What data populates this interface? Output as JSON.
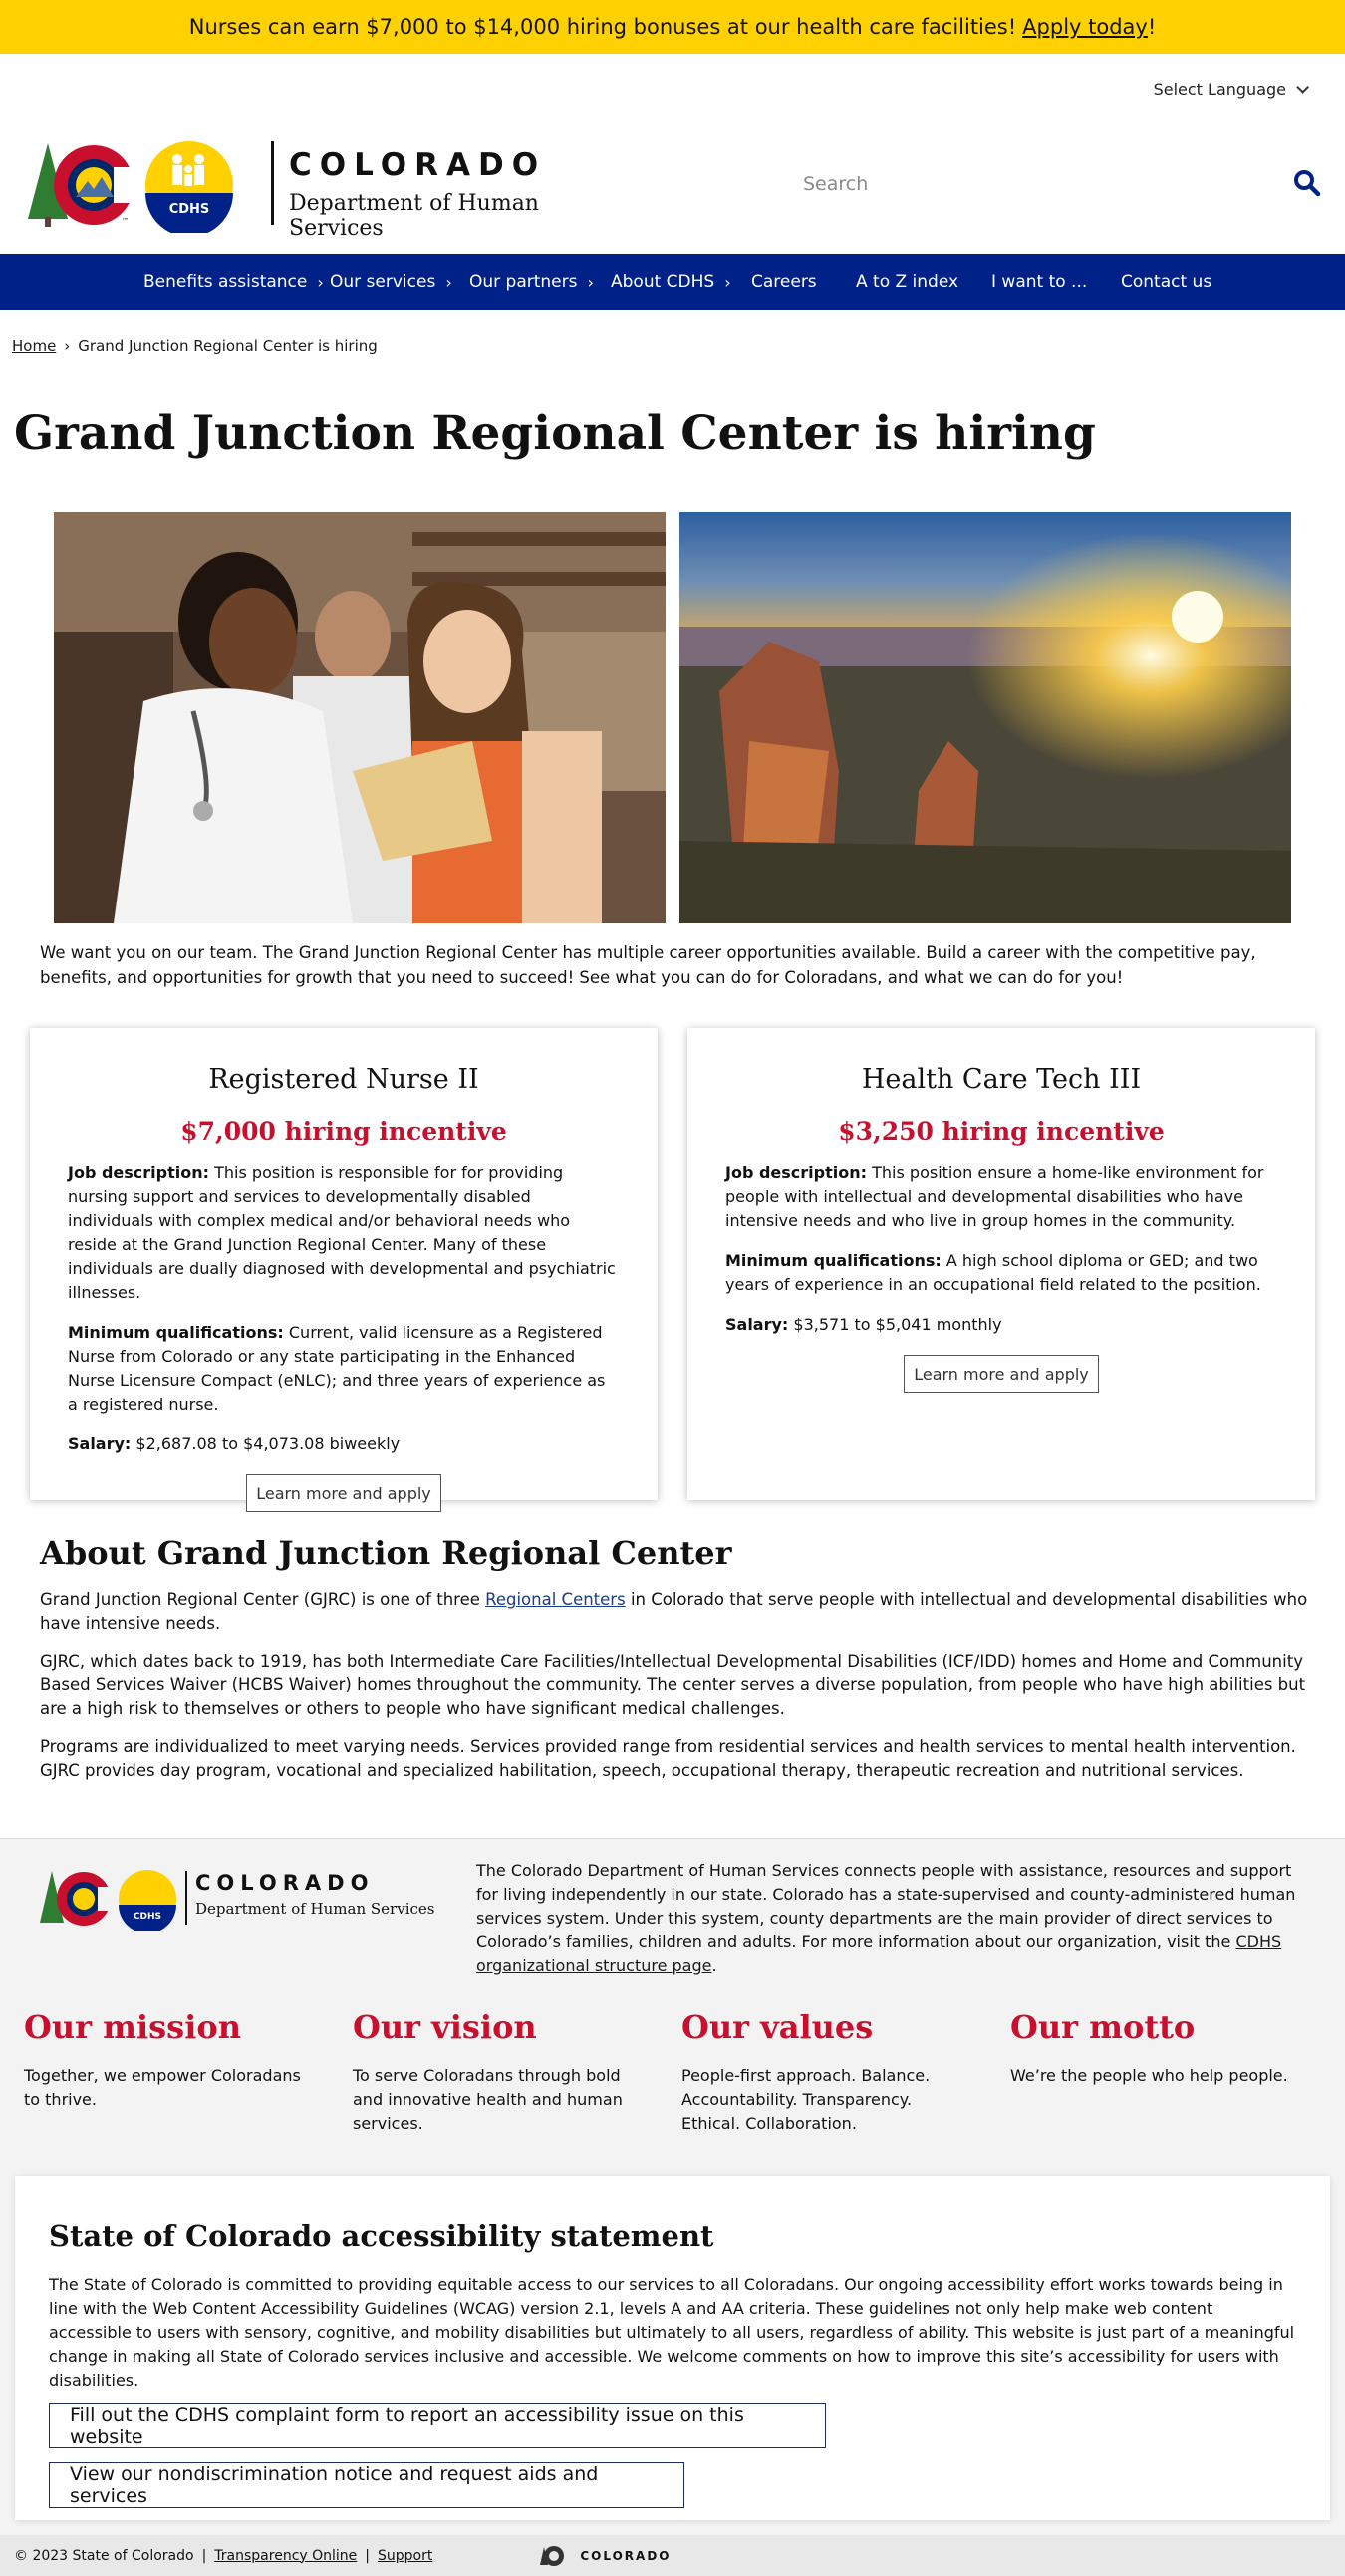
{
  "banner": {
    "text": "Nurses can earn $7,000 to $14,000 hiring bonuses at our health care facilities!",
    "link": "Apply today",
    "suffix": "!"
  },
  "header": {
    "language": "Select Language",
    "logo_state": "COLORADO",
    "logo_dept": "Department of Human Services",
    "logo_badge": "CDHS",
    "search_placeholder": "Search"
  },
  "nav": {
    "items": [
      {
        "label": "Benefits assistance",
        "arrow": "›"
      },
      {
        "label": "Our services",
        "arrow": "›"
      },
      {
        "label": "Our partners",
        "arrow": "›"
      },
      {
        "label": "About CDHS",
        "arrow": "›"
      },
      {
        "label": "Careers"
      },
      {
        "label": "A to Z index"
      },
      {
        "label": "I want to ..."
      },
      {
        "label": "Contact us"
      }
    ]
  },
  "breadcrumb": {
    "home": "Home",
    "sep": "›",
    "current": "Grand Junction Regional Center is hiring"
  },
  "page_title": "Grand Junction Regional Center is hiring",
  "intro": "We want you on our team. The Grand Junction Regional Center has multiple career opportunities available. Build a career with the competitive pay, benefits, and opportunities for growth that you need to succeed! See what you can do for Coloradans, and what we can do for you!",
  "jobs": [
    {
      "title": "Registered Nurse II",
      "incentive": "$7,000 hiring incentive",
      "desc_label": "Job description:",
      "desc": "This position is responsible for for providing nursing support and services to developmentally disabled individuals with complex medical and/or behavioral needs who reside at the Grand Junction Regional Center. Many of these individuals are dually diagnosed with developmental and psychiatric illnesses.",
      "qual_label": "Minimum qualifications:",
      "qual": "Current, valid licensure as a Registered Nurse from Colorado or any state participating in the Enhanced Nurse Licensure Compact (eNLC); and three years of experience as a registered nurse.",
      "salary_label": "Salary:",
      "salary": "$2,687.08 to $4,073.08 biweekly",
      "button": "Learn more and apply"
    },
    {
      "title": "Health Care Tech III",
      "incentive": "$3,250 hiring incentive",
      "desc_label": "Job description:",
      "desc": "This position ensure a home-like environment for people with intellectual and developmental disabilities who have intensive needs and who live in group homes in the community.",
      "qual_label": "Minimum qualifications:",
      "qual": "A high school diploma or GED; and two years of experience in an occupational field related to the position.",
      "salary_label": "Salary:",
      "salary": "$3,571 to $5,041 monthly",
      "button": "Learn more and apply"
    }
  ],
  "about": {
    "title": "About Grand Junction Regional Center",
    "p1_before": "Grand Junction Regional Center (GJRC) is one of three",
    "p1_link": "Regional Centers",
    "p1_after": "in Colorado that serve people with intellectual and developmental disabilities who have intensive needs.",
    "p2": "GJRC, which dates back to 1919, has both Intermediate Care Facilities/Intellectual Developmental Disabilities (ICF/IDD) homes and Home and Community Based Services Waiver (HCBS Waiver) homes throughout the community. The center serves a diverse population, from people who have high abilities but are a high risk to themselves or others to people who have significant medical challenges.",
    "p3": "Programs are individualized to meet varying needs. Services provided range from residential services and health services to mental health intervention. GJRC provides day program, vocational and specialized habilitation, speech, occupational therapy, therapeutic recreation and nutritional services."
  },
  "footer": {
    "desc_before": "The Colorado Department of Human Services connects people with assistance, resources and support for living independently in our state. Colorado has a state-supervised and county-administered human services system. Under this system, county departments are the main provider of direct services to Colorado’s families, children and adults. For more information about our organization, visit the",
    "desc_link": "CDHS organizational structure page",
    "desc_after": ".",
    "columns": [
      {
        "title": "Our mission",
        "text": "Together, we empower Coloradans to thrive."
      },
      {
        "title": "Our vision",
        "text": "To serve Coloradans through bold and innovative health and human services."
      },
      {
        "title": "Our values",
        "text": "People-first approach. Balance. Accountability. Transparency. Ethical. Collaboration."
      },
      {
        "title": "Our motto",
        "text": "We’re the people who help people."
      }
    ]
  },
  "accessibility": {
    "title": "State of Colorado accessibility statement",
    "text": "The State of Colorado is committed to providing equitable access to our services to all Coloradans. Our ongoing accessibility effort works towards being in line with the Web Content Accessibility Guidelines (WCAG) version 2.1, levels A and AA criteria. These guidelines not only help make web content accessible to users with sensory, cognitive, and mobility disabilities but ultimately to all users, regardless of ability. This website is just part of a meaningful change in making all State of Colorado services inclusive and accessible. We welcome comments on how to improve this site’s accessibility for users with disabilities.",
    "button1": "Fill out the CDHS complaint form to report an accessibility issue on this website",
    "button2": "View our nondiscrimination notice and request aids and services"
  },
  "bottom": {
    "copyright": "© 2023 State of Colorado",
    "sep": "|",
    "link1": "Transparency Online",
    "link2": "Support",
    "logo": "COLORADO"
  },
  "colors": {
    "banner": "#ffd100",
    "nav": "#002288",
    "accent_red": "#c8102e",
    "search_icon": "#002288"
  }
}
